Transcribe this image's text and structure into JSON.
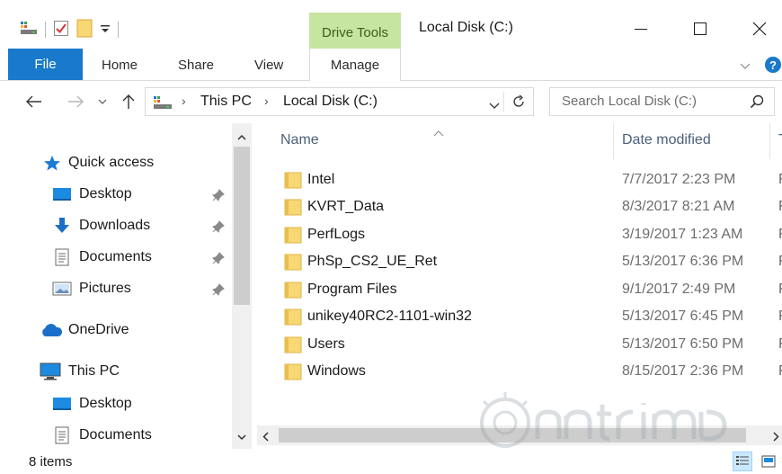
{
  "window": {
    "title": "Local Disk (C:)",
    "contextual_tab": "Drive Tools",
    "controls": [
      "minimize",
      "maximize",
      "close"
    ]
  },
  "ribbon": {
    "tabs": [
      "File",
      "Home",
      "Share",
      "View",
      "Manage"
    ],
    "active_tab": "File"
  },
  "address": {
    "breadcrumbs": [
      "This PC",
      "Local Disk (C:)"
    ],
    "search_placeholder": "Search Local Disk (C:)"
  },
  "nav_pane": {
    "items": [
      {
        "label": "Quick access",
        "icon": "star-icon",
        "pinned": false,
        "level": 0
      },
      {
        "label": "Desktop",
        "icon": "desktop-folder-icon",
        "pinned": true,
        "level": 1
      },
      {
        "label": "Downloads",
        "icon": "download-arrow-icon",
        "pinned": true,
        "level": 1
      },
      {
        "label": "Documents",
        "icon": "document-icon",
        "pinned": true,
        "level": 1
      },
      {
        "label": "Pictures",
        "icon": "pictures-icon",
        "pinned": true,
        "level": 1
      },
      {
        "label": "OneDrive",
        "icon": "cloud-icon",
        "pinned": false,
        "level": 0
      },
      {
        "label": "This PC",
        "icon": "computer-icon",
        "pinned": false,
        "level": 0
      },
      {
        "label": "Desktop",
        "icon": "desktop-folder-icon",
        "pinned": false,
        "level": 1
      },
      {
        "label": "Documents",
        "icon": "document-icon",
        "pinned": false,
        "level": 1
      }
    ]
  },
  "file_list": {
    "columns": [
      "Name",
      "Date modified",
      "T"
    ],
    "rows": [
      {
        "name": "Intel",
        "date": "7/7/2017 2:23 PM",
        "type": "F"
      },
      {
        "name": "KVRT_Data",
        "date": "8/3/2017 8:21 AM",
        "type": "F"
      },
      {
        "name": "PerfLogs",
        "date": "3/19/2017 1:23 AM",
        "type": "F"
      },
      {
        "name": "PhSp_CS2_UE_Ret",
        "date": "5/13/2017 6:36 PM",
        "type": "F"
      },
      {
        "name": "Program Files",
        "date": "9/1/2017 2:49 PM",
        "type": "F"
      },
      {
        "name": "unikey40RC2-1101-win32",
        "date": "5/13/2017 6:45 PM",
        "type": "F"
      },
      {
        "name": "Users",
        "date": "5/13/2017 6:50 PM",
        "type": "F"
      },
      {
        "name": "Windows",
        "date": "8/15/2017 2:36 PM",
        "type": "F"
      }
    ]
  },
  "status": {
    "item_count": "8 items"
  },
  "colors": {
    "file_tab": "#1979ca",
    "drive_tools": "#c6e5a0",
    "folder": "#f8d775",
    "column_header": "#4c607a"
  }
}
